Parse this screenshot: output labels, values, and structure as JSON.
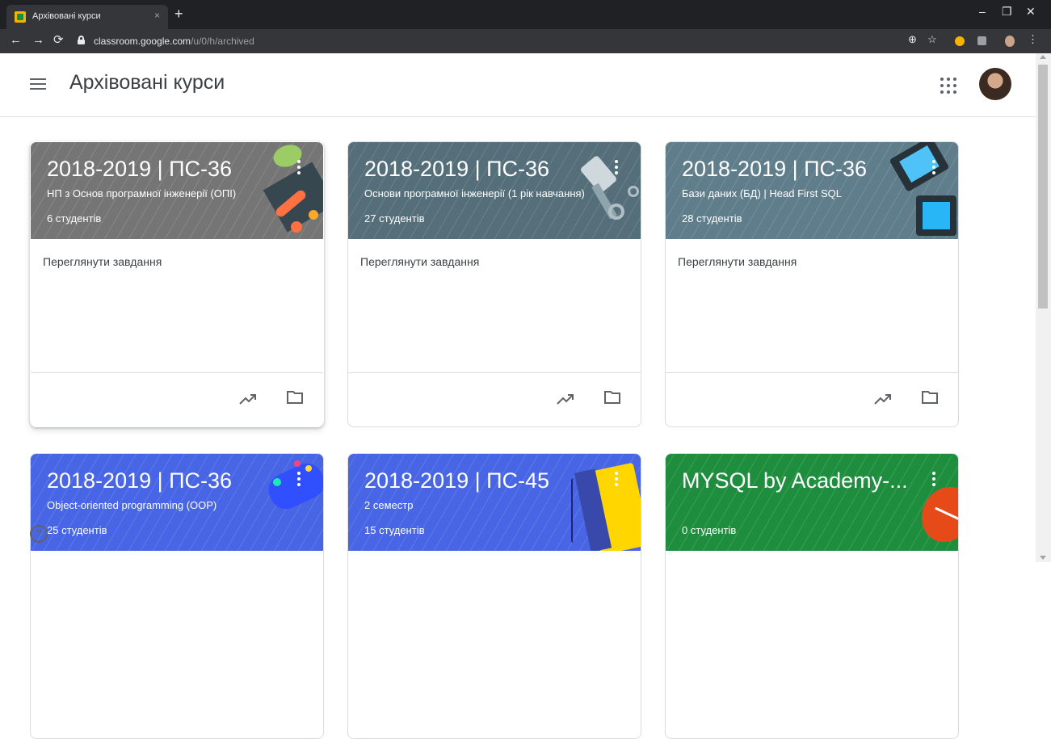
{
  "browser": {
    "tab_title": "Архівовані курси",
    "tab_close": "×",
    "new_tab": "+",
    "url_host": "classroom.google.com",
    "url_path": "/u/0/h/archived"
  },
  "app": {
    "page_title": "Архівовані курси",
    "help_label": "?"
  },
  "colors": {
    "grey": "#757575",
    "teal": "#546e7a",
    "slate": "#607d8b",
    "blue": "#4765e4",
    "green": "#1e8e3e"
  },
  "courses": [
    {
      "title": "2018-2019 | ПС-36",
      "subtitle": "НП з Основ програмної інженерії (ОПІ)",
      "students": "6 студентів",
      "link": "Переглянути завдання"
    },
    {
      "title": "2018-2019 | ПС-36",
      "subtitle": "Основи програмної інженерії (1 рік навчання)",
      "students": "27 студентів",
      "link": "Переглянути завдання"
    },
    {
      "title": "2018-2019 | ПС-36",
      "subtitle": "Бази даних (БД) | Head First SQL",
      "students": "28 студентів",
      "link": "Переглянути завдання"
    },
    {
      "title": "2018-2019 | ПС-36",
      "subtitle": "Object-oriented programming (OOP)",
      "students": "25 студентів"
    },
    {
      "title": "2018-2019 | ПС-45",
      "subtitle": "2 семестр",
      "students": "15 студентів"
    },
    {
      "title": "MYSQL by Academy-...",
      "subtitle": "",
      "students": "0 студентів"
    }
  ]
}
